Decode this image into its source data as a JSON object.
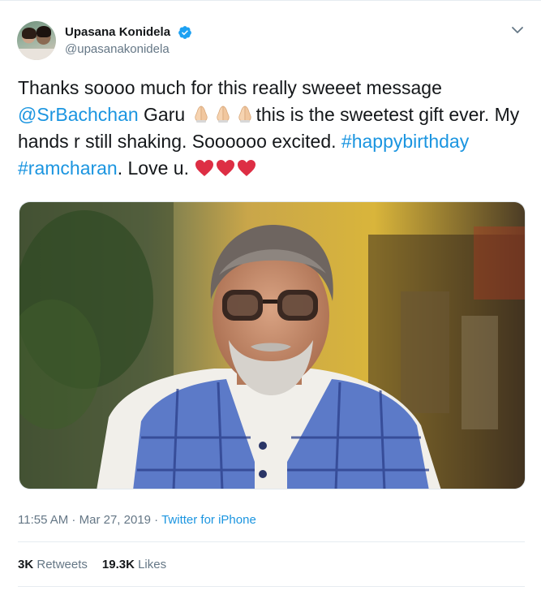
{
  "author": {
    "display_name": "Upasana Konidela",
    "handle": "@upasanakonidela",
    "avatar_icon": "profile-photo",
    "verified_icon": "verified-badge-icon"
  },
  "menu_icon": "chevron-down-icon",
  "tweet": {
    "text_1": "Thanks soooo much for this really sweeet message ",
    "mention": "@SrBachchan",
    "text_2": " Garu ",
    "emoji_1": "folded-hands-icon",
    "text_3": "this is the sweetest gift ever. My hands r still shaking.  Soooooo excited. ",
    "hashtag_1": "#happybirthday",
    "space": " ",
    "hashtag_2": "#ramcharan",
    "text_4": ". Love u. ",
    "emoji_2": "red-heart-icon"
  },
  "media": {
    "type": "video-thumbnail"
  },
  "meta": {
    "time": "11:55 AM",
    "sep1": " · ",
    "date": "Mar 27, 2019",
    "sep2": " · ",
    "source": "Twitter for iPhone"
  },
  "stats": {
    "retweets_count": "3K",
    "retweets_label": "Retweets",
    "likes_count": "19.3K",
    "likes_label": "Likes"
  },
  "colors": {
    "link": "#1b95e0",
    "text": "#14171a",
    "secondary": "#657786",
    "divider": "#e6ecf0"
  }
}
